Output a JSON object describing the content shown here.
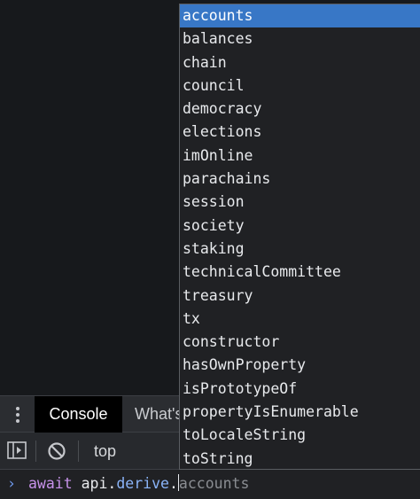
{
  "drawer": {
    "tabs": [
      {
        "label": "Console",
        "selected": true
      },
      {
        "label": "What's"
      }
    ]
  },
  "toolbar": {
    "context": "top"
  },
  "prompt": {
    "symbol": "›",
    "keyword": "await",
    "object": "api",
    "dot1": ".",
    "property": "derive",
    "dot2": ".",
    "ghost_completion": "accounts"
  },
  "autocomplete": {
    "selected_index": 0,
    "items": [
      "accounts",
      "balances",
      "chain",
      "council",
      "democracy",
      "elections",
      "imOnline",
      "parachains",
      "session",
      "society",
      "staking",
      "technicalCommittee",
      "treasury",
      "tx",
      "constructor",
      "hasOwnProperty",
      "isPrototypeOf",
      "propertyIsEnumerable",
      "toLocaleString",
      "toString"
    ]
  },
  "colors": {
    "selection": "#3877c6",
    "keyword": "#c792ea",
    "property": "#8ab4f8",
    "prompt_chevron": "#6f9bf0"
  },
  "icons": [
    "kebab-menu-icon",
    "sidebar-toggle-icon",
    "clear-console-icon"
  ]
}
